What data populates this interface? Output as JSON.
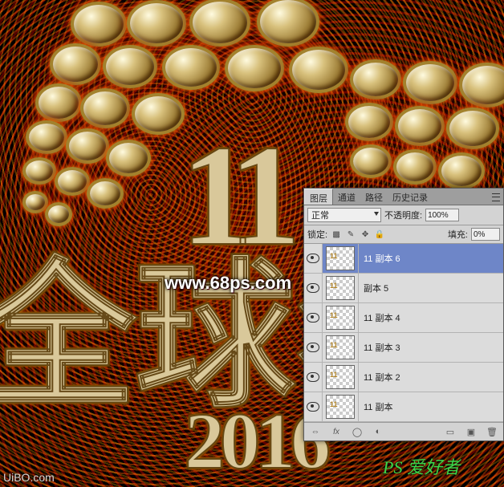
{
  "artwork": {
    "big_number": "11",
    "headline": "全球狂",
    "year": "2016",
    "watermark_main": "www.68ps.com",
    "watermark_sub": "UiBO.com",
    "watermark_corner": "PS 爱好者"
  },
  "panel": {
    "tabs": {
      "layers": "图层",
      "channels": "通道",
      "paths": "路径",
      "history": "历史记录"
    },
    "options": {
      "blend_mode": "正常",
      "opacity_label": "不透明度:",
      "opacity_value": "100%",
      "lock_label": "锁定:",
      "fill_label": "填充:",
      "fill_value": "0%"
    },
    "layers": [
      {
        "name": "11 副本 6",
        "visible": true,
        "selected": true
      },
      {
        "name": "副本 5",
        "visible": true,
        "selected": false
      },
      {
        "name": "11 副本 4",
        "visible": true,
        "selected": false
      },
      {
        "name": "11 副本 3",
        "visible": true,
        "selected": false
      },
      {
        "name": "11 副本 2",
        "visible": true,
        "selected": false
      },
      {
        "name": "11 副本",
        "visible": true,
        "selected": false
      }
    ],
    "footer": {
      "link": "⇔",
      "fx": "fx",
      "mask": "◯",
      "adjust": "◐",
      "folder": "▭",
      "new": "▣",
      "trash": "🗑"
    }
  }
}
